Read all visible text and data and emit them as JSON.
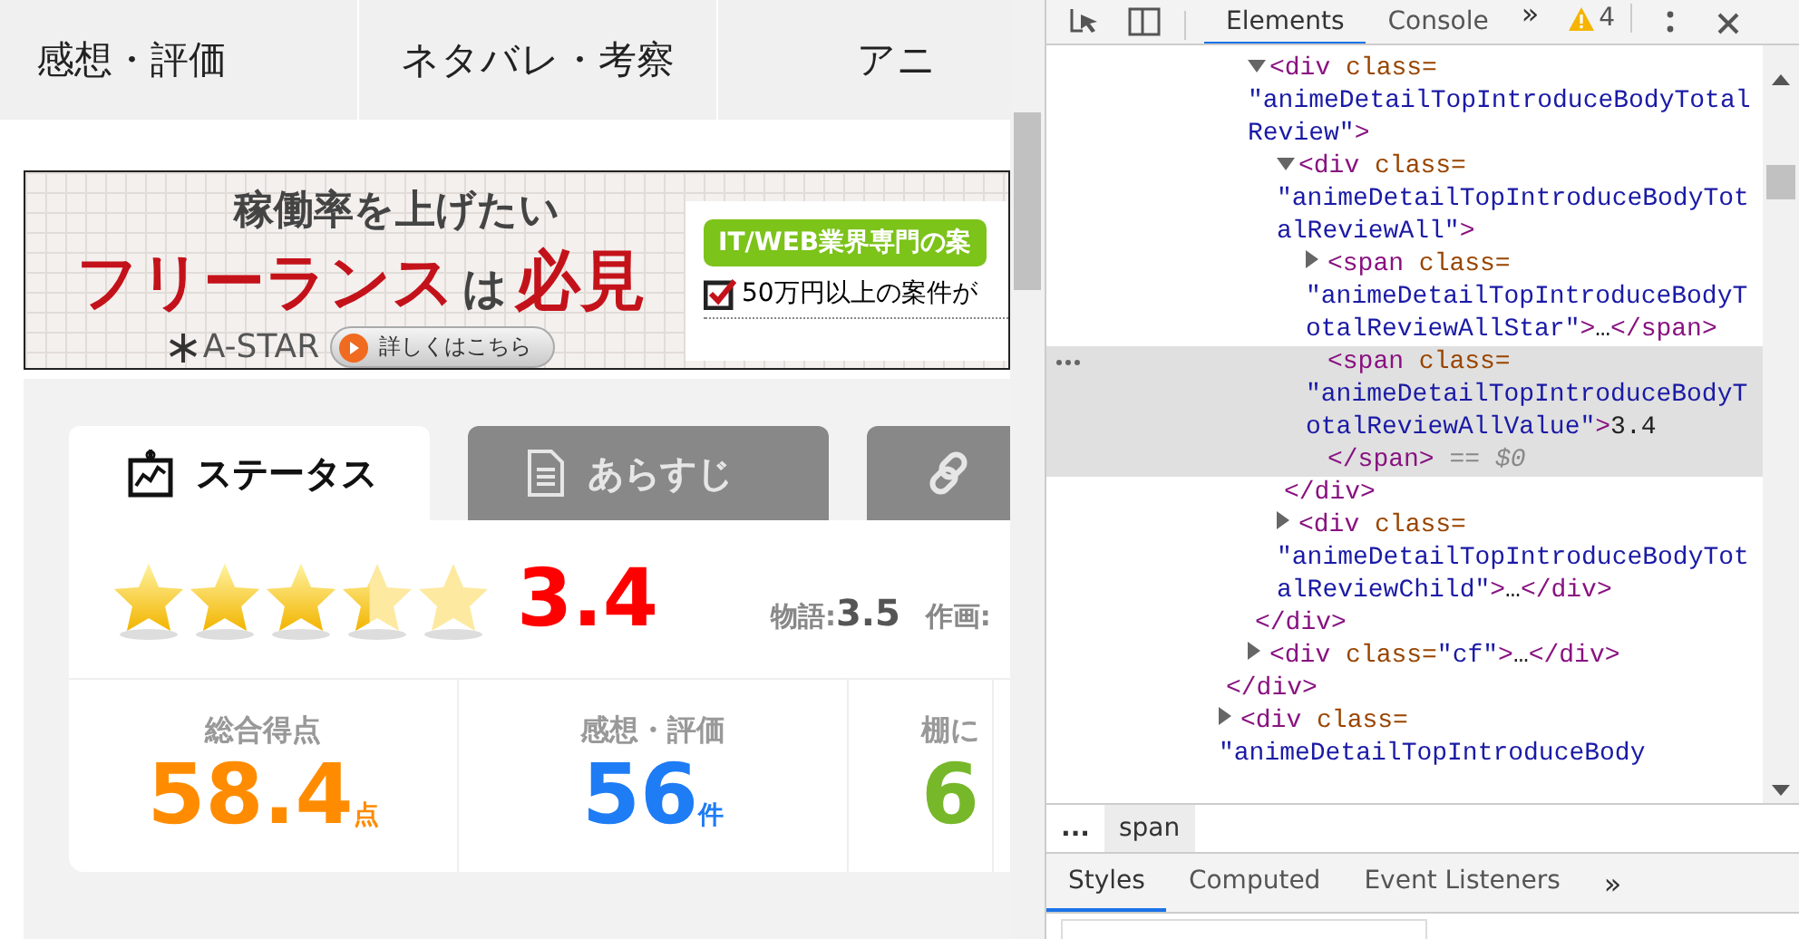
{
  "site": {
    "nav_tabs": [
      {
        "label": "感想・評価"
      },
      {
        "label": "ネタバレ・考察"
      },
      {
        "label": "アニ"
      }
    ],
    "banner": {
      "catch": "稼働率を上げたい",
      "title": "フリーランス",
      "title_particle": "は",
      "title_accent": "必見",
      "logo": "A-STAR",
      "button": "詳しくはこちら",
      "badge": "IT/WEB業界専門の案",
      "feature": "50万円以上の案件が"
    },
    "panel_tabs": [
      {
        "kind": "chart",
        "label": "ステータス",
        "selected": true
      },
      {
        "kind": "document",
        "label": "あらすじ",
        "selected": false
      },
      {
        "kind": "link",
        "selected": false
      }
    ],
    "rating": {
      "stars": 3.4,
      "score": "3.4",
      "sub_scores": [
        {
          "label": "物語:",
          "value": "3.5"
        },
        {
          "label": "作画:"
        }
      ]
    },
    "stats": [
      {
        "label": "総合得点",
        "value": "58.4",
        "unit": "点",
        "color": "#ff8c00"
      },
      {
        "label": "感想・評価",
        "value": "56",
        "unit": "件",
        "color": "#1e7cf5"
      },
      {
        "label": "棚に",
        "value": "6",
        "color": "#77b82a"
      }
    ]
  },
  "devtools": {
    "tabs": [
      {
        "label": "Elements",
        "selected": true
      },
      {
        "label": "Console",
        "selected": false
      }
    ],
    "more": "»",
    "warnings": "4",
    "dom_tree": [
      {
        "close": "</div>",
        "children": [
          {
            "markup": "<div class=\"animeDetailTopIntroduceBodyTotalReview\">",
            "expanded": true,
            "close": "</div>",
            "children": [
              {
                "markup": "<div class=\"animeDetailTopIntroduceBodyTotalReviewAll\">",
                "expanded": true,
                "close": "</div>",
                "children": [
                  {
                    "markup": "<span class=\"animeDetailTopIntroduceBodyTotalReviewAllStar\">…</span>",
                    "expanded": false,
                    "selected": false
                  },
                  {
                    "markup": "<span class=\"animeDetailTopIntroduceBodyTotalReviewAllValue\">3.4",
                    "close": "</span>",
                    "hint": "== $0",
                    "selected": true
                  }
                ]
              },
              {
                "markup": "<div class=\"animeDetailTopIntroduceBodyTotalReviewChild\">…</div>",
                "expanded": false,
                "selected": false
              }
            ]
          },
          {
            "markup": "<div class=\"cf\">…</div>",
            "expanded": false,
            "selected": false
          }
        ]
      },
      {
        "markup": "<div class=\"animeDetailTopIntroduceBody",
        "expanded": false,
        "selected": false
      }
    ],
    "breadcrumbs": [
      {
        "label": "...",
        "selected": false
      },
      {
        "label": "span",
        "selected": true
      }
    ],
    "panel_tabs": [
      {
        "label": "Styles",
        "selected": true
      },
      {
        "label": "Computed",
        "selected": false
      },
      {
        "label": "Event Listeners",
        "selected": false
      }
    ],
    "panel_more": "»"
  }
}
